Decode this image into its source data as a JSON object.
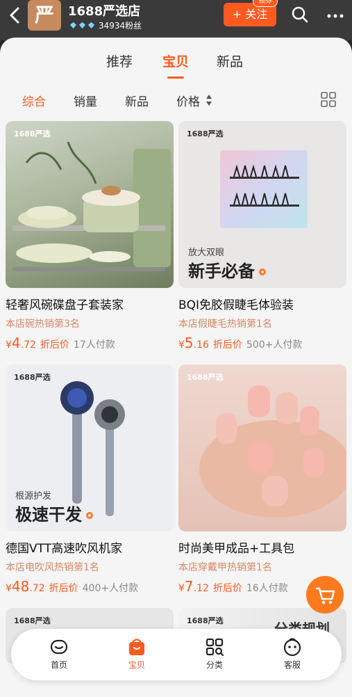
{
  "header": {
    "store_name": "1688严选店",
    "logo_char": "严",
    "fans": "34934粉丝",
    "follow_label": "+ 关注",
    "coupon_label": "领券"
  },
  "top_tabs": [
    {
      "label": "推荐",
      "active": false
    },
    {
      "label": "宝贝",
      "active": true
    },
    {
      "label": "新品",
      "active": false
    }
  ],
  "filters": [
    {
      "label": "综合",
      "active": true
    },
    {
      "label": "销量",
      "active": false
    },
    {
      "label": "新品",
      "active": false
    },
    {
      "label": "价格",
      "active": false
    }
  ],
  "products": [
    {
      "brand": "1688严选",
      "title": "轻奢风碗碟盘子套装家",
      "rank": "本店碗热销第3名",
      "price_int": "4",
      "price_dec": ".72",
      "price_tag": "折后价",
      "sold": "17人付款",
      "overlay_small": "",
      "overlay_big": ""
    },
    {
      "brand": "1688严选",
      "title": "BQI免胶假睫毛体验装",
      "rank": "本店假睫毛热销第1名",
      "price_int": "5",
      "price_dec": ".16",
      "price_tag": "折后价",
      "sold": "500+人付款",
      "overlay_small": "放大双眼",
      "overlay_big": "新手必备"
    },
    {
      "brand": "1688严选",
      "title": "德国VTT高速吹风机家",
      "rank": "本店电吹风热销第1名",
      "price_int": "48",
      "price_dec": ".72",
      "price_tag": "折后价",
      "sold": "400+人付款",
      "overlay_small": "根源护发",
      "overlay_big": "极速干发"
    },
    {
      "brand": "1688严选",
      "title": "时尚美甲成品+工具包",
      "rank": "本店穿戴甲热销第1名",
      "price_int": "7",
      "price_dec": ".12",
      "price_tag": "折后价",
      "sold": "16人付款",
      "overlay_small": "",
      "overlay_big": ""
    }
  ],
  "partial_cards": [
    {
      "brand": "1688严选",
      "overlay": ""
    },
    {
      "brand": "1688严选",
      "overlay": "分类规划"
    }
  ],
  "currency": "¥",
  "nav": [
    {
      "label": "首页",
      "icon": "home-icon",
      "active": false
    },
    {
      "label": "宝贝",
      "icon": "bag-icon",
      "active": true
    },
    {
      "label": "分类",
      "icon": "category-icon",
      "active": false
    },
    {
      "label": "客服",
      "icon": "service-icon",
      "active": false
    }
  ],
  "colors": {
    "accent": "#ff5a1f",
    "header_bg": "#3a3a3a",
    "rank_text": "#d88866"
  }
}
